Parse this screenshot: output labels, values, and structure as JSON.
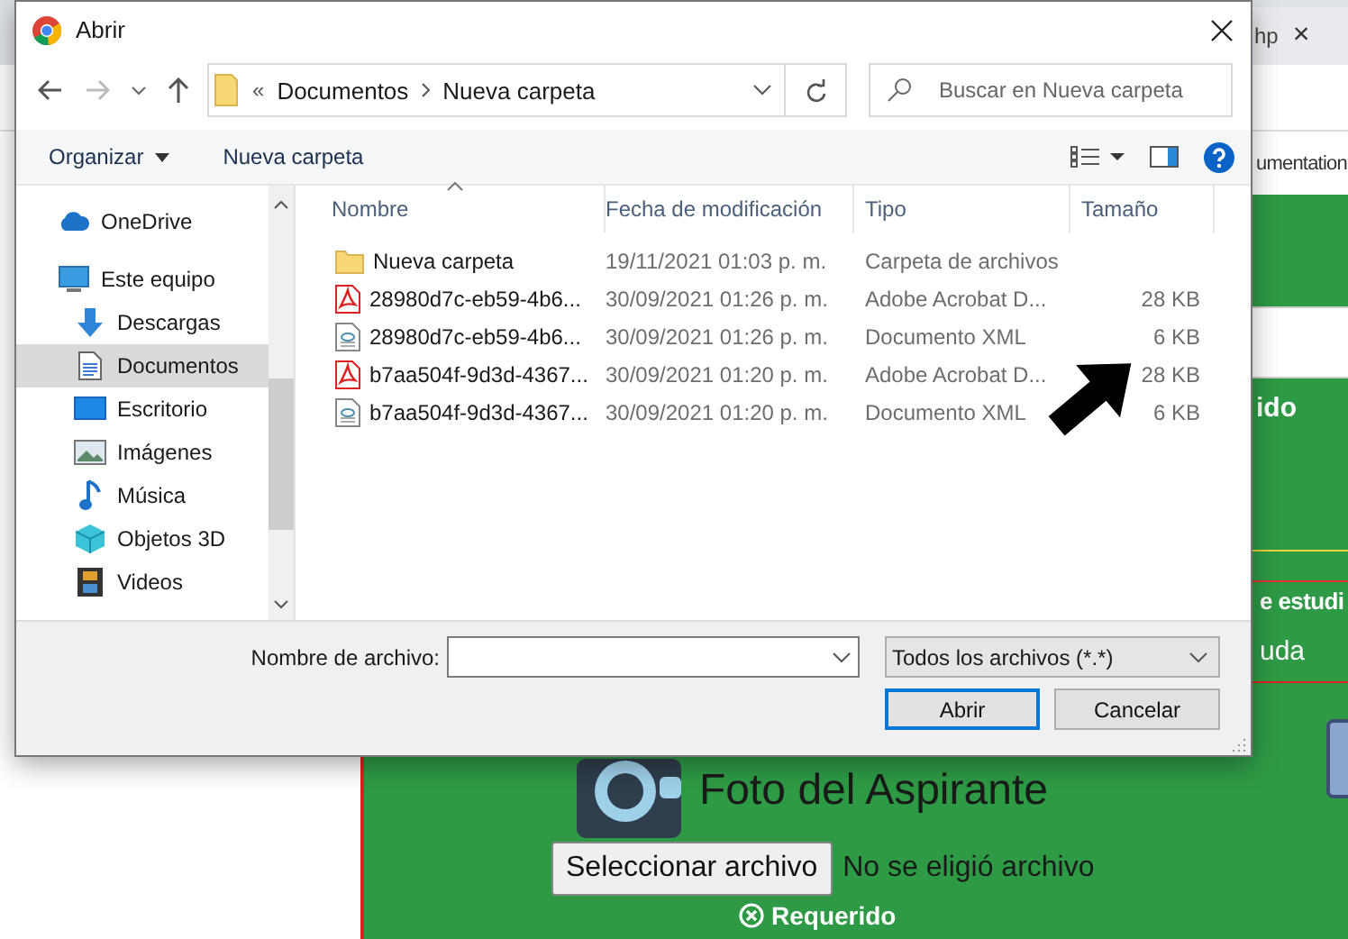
{
  "browser": {
    "tab": {
      "title": "hp",
      "close": "×"
    },
    "bookmark": "umentation"
  },
  "page": {
    "partly_hidden_texts": [
      "ido",
      "e estudi",
      "uda"
    ],
    "photo_section": {
      "title": "Foto del Aspirante",
      "choose_button": "Seleccionar archivo",
      "file_status": "No se eligió archivo",
      "required": "Requerido"
    }
  },
  "dialog": {
    "title": "Abrir",
    "address": {
      "overflow": "«",
      "path": [
        "Documentos",
        "Nueva carpeta"
      ]
    },
    "search": {
      "placeholder": "Buscar en Nueva carpeta"
    },
    "toolbar": {
      "organize": "Organizar",
      "new_folder": "Nueva carpeta"
    },
    "nav_items": [
      {
        "label": "OneDrive",
        "kind": "cloud",
        "selected": false
      },
      {
        "label": "Este equipo",
        "kind": "pc",
        "selected": false,
        "children": [
          {
            "label": "Descargas",
            "kind": "download",
            "selected": false
          },
          {
            "label": "Documentos",
            "kind": "documents",
            "selected": true
          },
          {
            "label": "Escritorio",
            "kind": "desktop",
            "selected": false
          },
          {
            "label": "Imágenes",
            "kind": "pictures",
            "selected": false
          },
          {
            "label": "Música",
            "kind": "music",
            "selected": false
          },
          {
            "label": "Objetos 3D",
            "kind": "objects",
            "selected": false
          },
          {
            "label": "Videos",
            "kind": "videos",
            "selected": false
          }
        ]
      }
    ],
    "columns": [
      {
        "label": "Nombre",
        "sorted": true
      },
      {
        "label": "Fecha de modificación",
        "sorted": false
      },
      {
        "label": "Tipo",
        "sorted": false
      },
      {
        "label": "Tamaño",
        "sorted": false
      }
    ],
    "files": [
      {
        "kind": "folder",
        "name": "Nueva carpeta",
        "modified": "19/11/2021 01:03 p. m.",
        "type": "Carpeta de archivos"
      },
      {
        "kind": "pdf",
        "name": "28980d7c-eb59-4b6...",
        "modified": "30/09/2021 01:26 p. m.",
        "type": "Adobe Acrobat D...",
        "size": "28 KB"
      },
      {
        "kind": "xml",
        "name": "28980d7c-eb59-4b6...",
        "modified": "30/09/2021 01:26 p. m.",
        "type": "Documento XML",
        "size": "6 KB"
      },
      {
        "kind": "pdf",
        "name": "b7aa504f-9d3d-4367...",
        "modified": "30/09/2021 01:20 p. m.",
        "type": "Adobe Acrobat D...",
        "size": "28 KB"
      },
      {
        "kind": "xml",
        "name": "b7aa504f-9d3d-4367...",
        "modified": "30/09/2021 01:20 p. m.",
        "type": "Documento XML",
        "size": "6 KB"
      }
    ],
    "file_name_label": "Nombre de archivo:",
    "filter": "Todos los archivos (*.*)",
    "buttons": [
      {
        "label": "Abrir",
        "default": true
      },
      {
        "label": "Cancelar",
        "default": false
      }
    ]
  }
}
